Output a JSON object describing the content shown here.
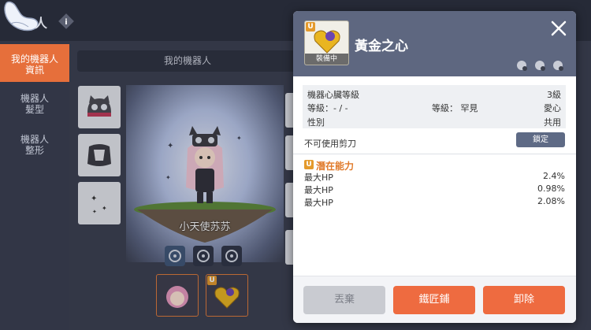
{
  "window": {
    "title_fragment": "人"
  },
  "nav": {
    "items": [
      {
        "label_line1": "我的機器人",
        "label_line2": "資訊",
        "active": true
      },
      {
        "label_line1": "機器人",
        "label_line2": "髮型",
        "active": false
      },
      {
        "label_line1": "機器人",
        "label_line2": "整形",
        "active": false
      }
    ]
  },
  "main": {
    "tab_label": "我的機器人",
    "character_name": "小天使苏苏"
  },
  "popup": {
    "item_name": "黃金之心",
    "item_badge": "U",
    "equipped_label": "裝備中",
    "stats": {
      "heart_level_label": "機器心臟等級",
      "heart_level_value": "3級",
      "grade_label": "等級：- / -",
      "grade_mid": "等級： 罕見",
      "grade_value": "愛心",
      "gender_label": "性別",
      "gender_value": "共用"
    },
    "scissors_label": "不可使用剪刀",
    "lock_label": "鎖定",
    "potential": {
      "badge": "U",
      "title": "潛在能力",
      "lines": [
        {
          "label": "最大HP",
          "value": "2.4%"
        },
        {
          "label": "最大HP",
          "value": "0.98%"
        },
        {
          "label": "最大HP",
          "value": "2.08%"
        }
      ]
    },
    "buttons": {
      "discard": "丟棄",
      "blacksmith": "鐵匠鋪",
      "unequip": "卸除"
    }
  },
  "colors": {
    "accent": "#ee6b40",
    "header": "#5e6780",
    "potential": "#e07a2a"
  }
}
